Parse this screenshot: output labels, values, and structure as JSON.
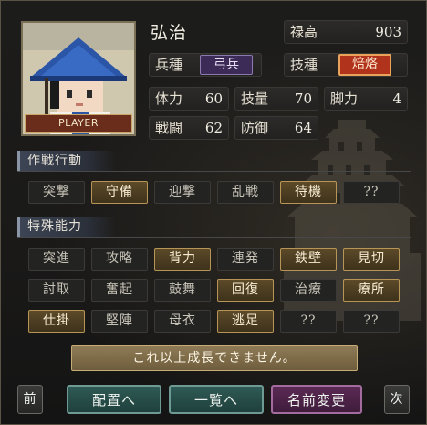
{
  "character": {
    "name": "弘治",
    "portrait_label": "PLAYER",
    "stats": {
      "roku_label": "禄高",
      "roku_value": "903",
      "troop_label": "兵種",
      "troop_value": "弓兵",
      "tech_label": "技種",
      "tech_value": "焙烙",
      "hp_label": "体力",
      "hp_value": "60",
      "skill_label": "技量",
      "skill_value": "70",
      "leg_label": "脚力",
      "leg_value": "4",
      "combat_label": "戦闘",
      "combat_value": "62",
      "defense_label": "防御",
      "defense_value": "64"
    }
  },
  "tactics": {
    "title": "作戦行動",
    "items": [
      {
        "label": "突撃",
        "active": false
      },
      {
        "label": "守備",
        "active": true
      },
      {
        "label": "迎撃",
        "active": false
      },
      {
        "label": "乱戦",
        "active": false
      },
      {
        "label": "待機",
        "active": true
      },
      {
        "label": "??",
        "active": false
      }
    ]
  },
  "abilities": {
    "title": "特殊能力",
    "rows": [
      [
        {
          "label": "突進",
          "active": false
        },
        {
          "label": "攻略",
          "active": false
        },
        {
          "label": "背力",
          "active": true
        },
        {
          "label": "連発",
          "active": false
        },
        {
          "label": "鉄壁",
          "active": true
        },
        {
          "label": "見切",
          "active": true
        }
      ],
      [
        {
          "label": "討取",
          "active": false
        },
        {
          "label": "奮起",
          "active": false
        },
        {
          "label": "鼓舞",
          "active": false
        },
        {
          "label": "回復",
          "active": true
        },
        {
          "label": "治療",
          "active": false
        },
        {
          "label": "療所",
          "active": true
        }
      ],
      [
        {
          "label": "仕掛",
          "active": true
        },
        {
          "label": "堅陣",
          "active": false
        },
        {
          "label": "母衣",
          "active": false
        },
        {
          "label": "逃足",
          "active": true
        },
        {
          "label": "??",
          "active": false
        },
        {
          "label": "??",
          "active": false
        }
      ]
    ]
  },
  "message": "これ以上成長できません。",
  "footer": {
    "prev": "前",
    "deploy": "配置へ",
    "list": "一覧へ",
    "rename": "名前変更",
    "next": "次"
  }
}
